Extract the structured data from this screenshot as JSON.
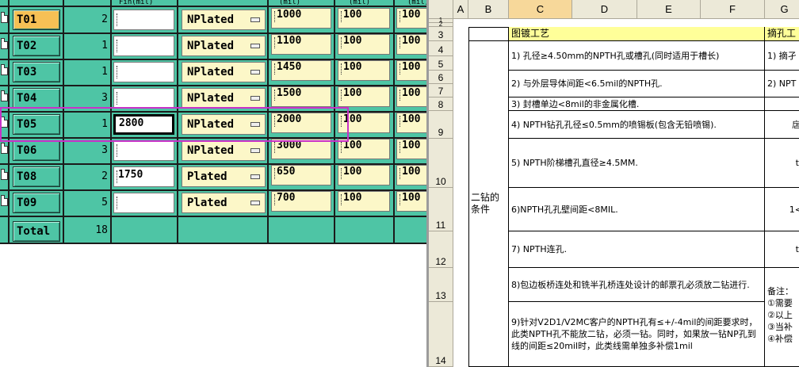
{
  "left_form": {
    "header_fragments": [
      "Fin(mil)",
      "(mil)",
      "(mil)",
      "(mil)"
    ],
    "rows": [
      {
        "tool": "T01",
        "qty": "2",
        "value": "",
        "plating": "NPlated",
        "size": "1000",
        "tol": "100",
        "extra": "100",
        "selected_tool": true
      },
      {
        "tool": "T02",
        "qty": "1",
        "value": "",
        "plating": "NPlated",
        "size": "1100",
        "tol": "100",
        "extra": "100"
      },
      {
        "tool": "T03",
        "qty": "1",
        "value": "",
        "plating": "NPlated",
        "size": "1450",
        "tol": "100",
        "extra": "100"
      },
      {
        "tool": "T04",
        "qty": "3",
        "value": "",
        "plating": "NPlated",
        "size": "1500",
        "tol": "100",
        "extra": "100"
      },
      {
        "tool": "T05",
        "qty": "1",
        "value": "2800",
        "plating": "NPlated",
        "size": "2000",
        "tol": "100",
        "extra": "100",
        "selected_input": true
      },
      {
        "tool": "T06",
        "qty": "3",
        "value": "",
        "plating": "NPlated",
        "size": "3000",
        "tol": "100",
        "extra": "100"
      },
      {
        "tool": "T08",
        "qty": "2",
        "value": "1750",
        "plating": "Plated",
        "size": "650",
        "tol": "100",
        "extra": "100"
      },
      {
        "tool": "T09",
        "qty": "5",
        "value": "",
        "plating": "Plated",
        "size": "700",
        "tol": "100",
        "extra": "100"
      }
    ],
    "total_label": "Total",
    "total_value": "18",
    "colors": {
      "background": "#4ec5a5",
      "field": "#fcf7c8",
      "selected_button": "#f6c055",
      "highlight": "#c832c8"
    }
  },
  "spreadsheet": {
    "columns": [
      "A",
      "B",
      "C",
      "D",
      "E",
      "F",
      "G"
    ],
    "active_column": "C",
    "rows": [
      "1",
      "2",
      "3",
      "4",
      "5",
      "6",
      "7",
      "8",
      "9",
      "10",
      "11",
      "12",
      "13",
      "14"
    ],
    "header_c": "图镀工艺",
    "header_g": "摘孔工",
    "section_label": "二钻的条件",
    "items": [
      "1) 孔径≥4.50mm的NPTH孔或槽孔(同时适用于槽长)",
      "2) 与外层导体间距<6.5mil的NPTH孔.",
      "3) 封槽单边<8mil的非金属化槽.",
      "4) NPTH钻孔孔径≤0.5mm的喷锡板(包含无铅喷锡).",
      "5) NPTH阶梯槽孔直径≥4.5MM.",
      "6)NPTH孔孔壁间距<8MIL.",
      "7) NPTH连孔.",
      "8)包边板桥连处和铣半孔桥连处设计的邮票孔必须放二钻进行.",
      "9)针对V2D1/V2MC客户的NPTH孔有≤+/-4mil的间距要求时，此类NPTH孔不能放二钻，必须一钻。同时，如果放一钻NP孔到线的间距≤20mil时，此类线需单独多补偿1mil"
    ],
    "g_fragments": [
      "1) 摘孑",
      "2) NPT",
      "",
      "扂",
      "t",
      "1<",
      "t",
      "备注：",
      "①需要",
      "②以上",
      "③当补",
      "④补偿"
    ]
  }
}
